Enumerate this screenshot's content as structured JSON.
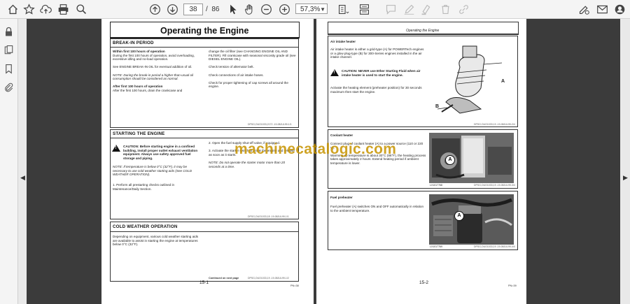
{
  "toolbar": {
    "page_current": "38",
    "page_total": "86",
    "page_sep": "/",
    "zoom": "57,3%"
  },
  "watermark": "machinecatalogic.com",
  "page1": {
    "title": "Operating the Engine",
    "breakin": {
      "heading": "BREAK-IN PERIOD",
      "sub1": "Within first 100 hours of operation",
      "col1_p1": "During the first 100 hours of operation, avoid overloading, excessive idling and no-load operation.",
      "col1_p2": "See ENGINE BREAK-IN OIL for eventual addition of oil.",
      "col1_note": "NOTE:  During the break-in period a higher-than-usual oil consumption should be considered as normal.",
      "sub2": "After first 100 hours of operation",
      "col1_p3": "After the first 100 hours, drain the crankcase and",
      "col2_p1": "change the oil filter (see CHANGING ENGINE OIL AND FILTER). Fill crankcase with seasonal viscosity grade oil (see DIESEL ENGINE OIL).",
      "col2_p2": "Check tension of alternator belt.",
      "col2_p3": "Check connections of air intake hoses.",
      "col2_p4": "Check for proper tightening of cap screws all around the engine.",
      "ref": "DPSG,OUO1033,2172   -19-08JUL99-1/1"
    },
    "starting": {
      "heading": "STARTING THE ENGINE",
      "caution": "CAUTION: Before starting engine in a confined building, install proper outlet exhaust ventilation equipment. Always use safety approved fuel storage and piping.",
      "note": "NOTE:  If temperature is below 0°C (32°F), it may be necessary to use cold weather starting aids (See COLD WEATHER OPERATION).",
      "step1": "1.  Perform all prestarting checks outlined in Maintenance/Daily Section.",
      "step2": "2.  Open the fuel supply shut-off valve, if equipped.",
      "step3": "3.  Activate the starter switch to crank the engine and release as soon as it starts.",
      "note2": "NOTE:  Do not operate the starter motor more than 20 seconds at a time.",
      "ref": "DPSG,OUO1033,18   -19-08JUL99-1/1"
    },
    "cold": {
      "heading": "COLD WEATHER OPERATION",
      "p1": "Depending on equipment, various cold weather starting aids are available to assist in starting the engine at temperatures below 0°C (32°F).",
      "continued": "Continued on next page",
      "ref": "DPSG,OUO1033,19   -19-08JUL99-1/2"
    },
    "page_no": "15-1",
    "foot_ref": "PN=38"
  },
  "page2": {
    "header": "Operating the Engine",
    "air": {
      "heading": "Air intake heater",
      "p1": "Air intake heater is either a grid-type (A) for POWERTech engines or a glow plug-type (B) for 300-Series engines installed in the air intake channel.",
      "caution": "CAUTION: NEVER use Ether Starting Fluid when air intake heater is used to start the engine.",
      "p2": "Activate the heating element (preheater position) for 30 seconds maximum then start the engine.",
      "label_a": "A",
      "label_b": "B",
      "ref": "DPSG,OUO1033,19   -19-08JUL99-2/4"
    },
    "coolant": {
      "heading": "Coolant heater",
      "p1": "Connect plug of coolant heater (A) to a power source (110 or 220 V).",
      "p2": "Warming up temperature is about 30°C (86°F), the heating process takes approximately 2 hours. Extend heating period if ambient temperature is lower.",
      "label_a": "A",
      "photo_ref": "LX1017768",
      "ref": "DPSG,OUO1033,19   -19-08JUL99-3/4"
    },
    "fuel": {
      "heading": "Fuel preheater",
      "p1": "Fuel preheater (A) switches ON and OFF automatically in relation to the ambient temperature.",
      "label_a": "A",
      "photo_ref": "LX1017769",
      "ref": "DPSG,OUO1033,19   -19-08JUL99-4/4"
    },
    "page_no": "15-2",
    "foot_ref": "PN=39"
  }
}
